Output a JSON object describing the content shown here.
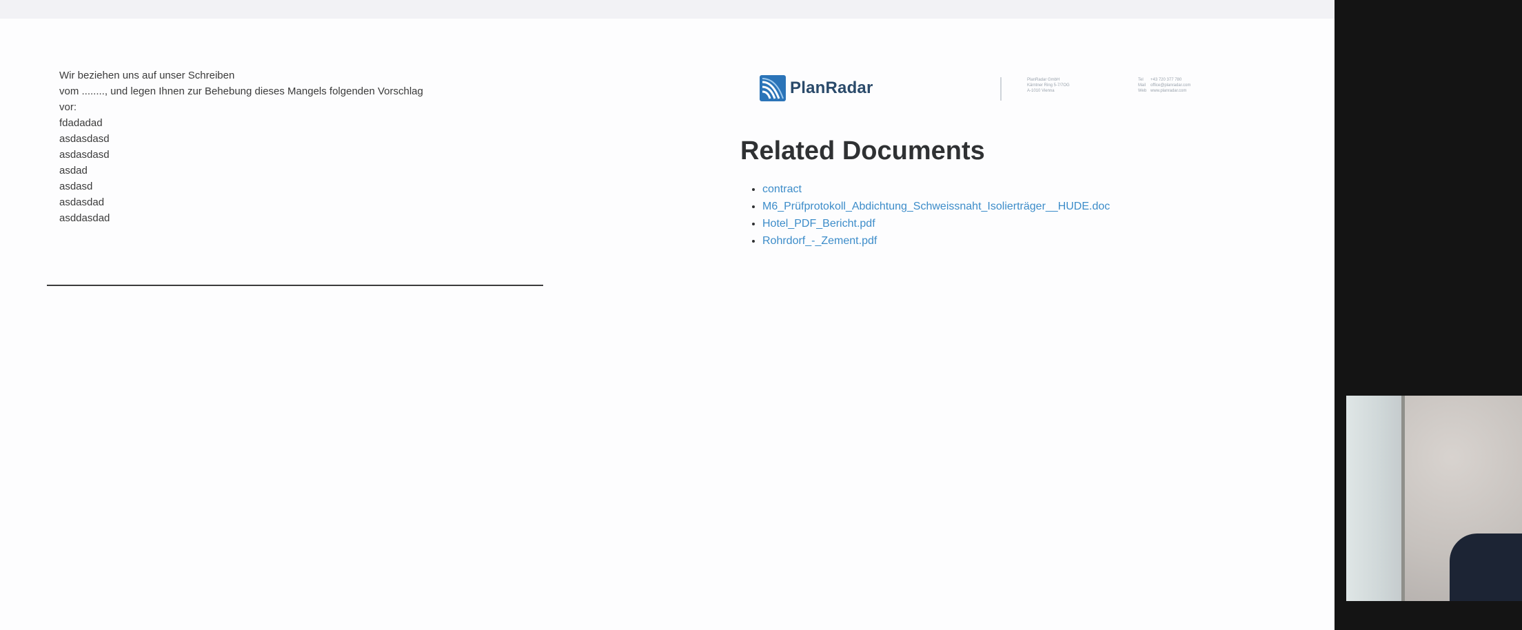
{
  "letter": {
    "lines": [
      "Wir beziehen uns auf unser Schreiben",
      "vom ........, und legen Ihnen zur Behebung dieses Mangels folgenden Vorschlag",
      "vor:",
      "fdadadad",
      "asdasdasd",
      "asdasdasd",
      "asdad",
      "asdasd",
      "asdasdad",
      "asddasdad"
    ]
  },
  "header": {
    "logo_text": "PlanRadar",
    "company_address": [
      "PlanRadar GmbH",
      "Kärntner Ring 5-7/7OG",
      "A-1010 Vienna"
    ],
    "contact": [
      {
        "label": "Tel",
        "value": "+43 720 377 780"
      },
      {
        "label": "Mail",
        "value": "office@planradar.com"
      },
      {
        "label": "Web",
        "value": "www.planradar.com"
      }
    ],
    "brand_color": "#2a4a6a"
  },
  "related": {
    "title": "Related Documents",
    "documents": [
      "contract",
      "M6_Prüfprotokoll_Abdichtung_Schweissnaht_Isolierträger__HUDE.doc",
      "Hotel_PDF_Bericht.pdf",
      "Rohrdorf_-_Zement.pdf"
    ],
    "link_color": "#3c8cc9"
  },
  "icons": {
    "logo": "planradar-logo-icon",
    "bullet": "disc"
  }
}
